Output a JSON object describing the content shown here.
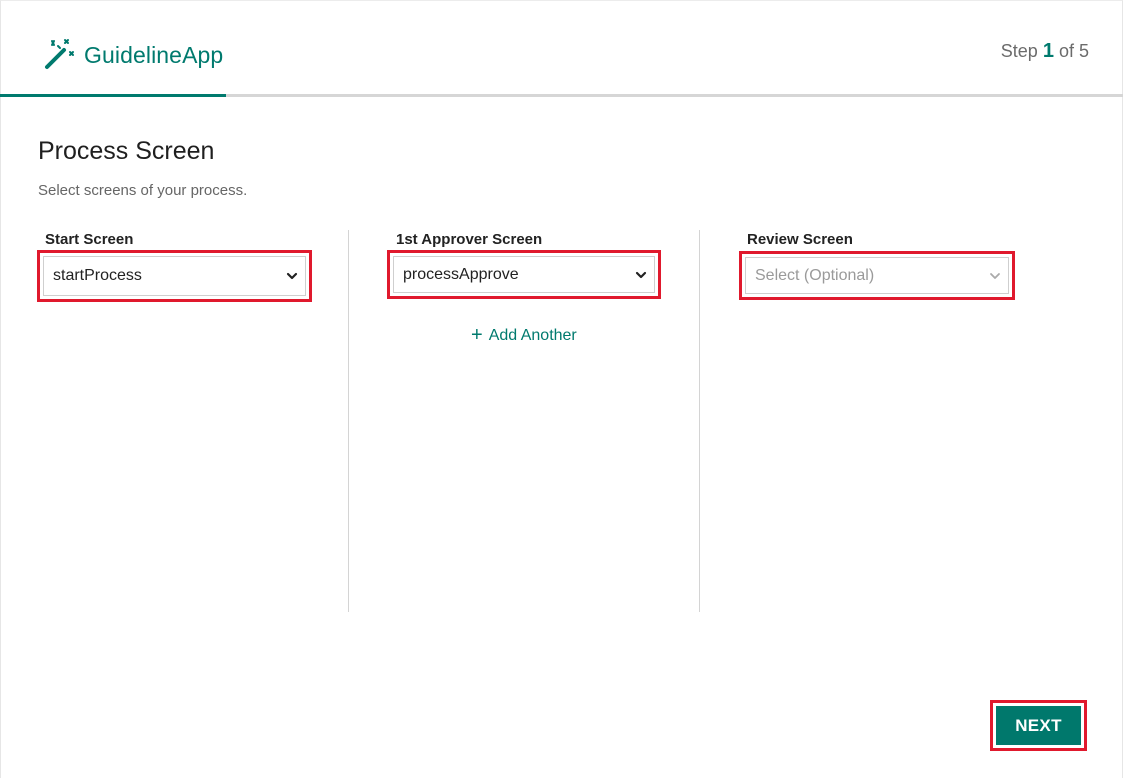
{
  "app": {
    "name": "GuidelineApp",
    "accent_color": "#007a6e",
    "icon": "magic-wand-icon"
  },
  "stepper": {
    "prefix": "Step",
    "current": "1",
    "separator": "of",
    "total": "5",
    "progress_fraction": 0.2
  },
  "page": {
    "title": "Process Screen",
    "description": "Select screens of your process."
  },
  "fields": {
    "start": {
      "label": "Start Screen",
      "value": "startProcess"
    },
    "approver": {
      "label": "1st Approver Screen",
      "value": "processApprove"
    },
    "review": {
      "label": "Review Screen",
      "placeholder": "Select (Optional)"
    }
  },
  "add_another": {
    "label": "Add Another",
    "icon": "plus-icon"
  },
  "footer": {
    "next_label": "NEXT"
  },
  "highlight_color": "#e0192d"
}
